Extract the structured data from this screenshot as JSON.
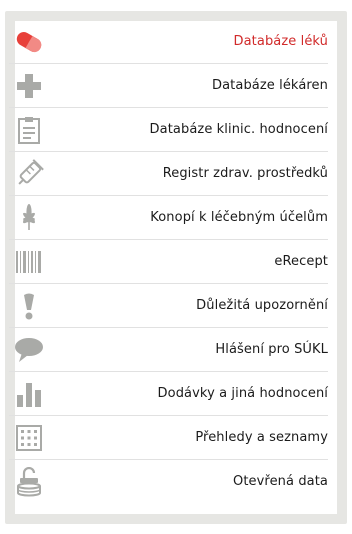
{
  "menu": {
    "items": [
      {
        "label": "Databáze léků",
        "icon": "pill-icon",
        "active": true
      },
      {
        "label": "Databáze lékáren",
        "icon": "pharmacy-cross-icon"
      },
      {
        "label": "Databáze klinic. hodnocení",
        "icon": "clipboard-icon"
      },
      {
        "label": "Registr zdrav. prostředků",
        "icon": "syringe-icon"
      },
      {
        "label": "Konopí k léčebným účelům",
        "icon": "cannabis-leaf-icon"
      },
      {
        "label": "eRecept",
        "icon": "barcode-icon"
      },
      {
        "label": "Důležitá upozornění",
        "icon": "exclamation-icon"
      },
      {
        "label": "Hlášení pro SÚKL",
        "icon": "speech-bubble-icon"
      },
      {
        "label": "Dodávky a jiná hodnocení",
        "icon": "bar-chart-icon"
      },
      {
        "label": "Přehledy a seznamy",
        "icon": "grid-table-icon"
      },
      {
        "label": "Otevřená data",
        "icon": "open-lock-database-icon"
      }
    ]
  },
  "colors": {
    "active_label": "#d12a2a",
    "active_icon": "#e8403a",
    "icon_gray": "#a9aaa7",
    "border": "#e6e6e3"
  }
}
